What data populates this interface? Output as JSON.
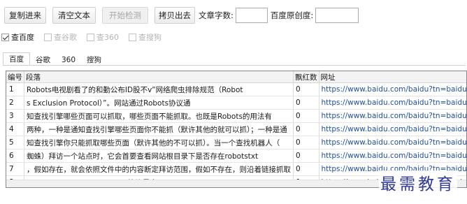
{
  "toolbar": {
    "copy_in_label": "复制进来",
    "clear_label": "清空文本",
    "start_label": "开始检测",
    "copy_out_label": "拷贝出去",
    "char_count_label": "文章字数:",
    "char_count_value": "",
    "originality_label": "百度原创度:",
    "originality_value": ""
  },
  "engines": [
    {
      "label": "查百度",
      "checked": true
    },
    {
      "label": "查谷歌",
      "checked": false
    },
    {
      "label": "查360",
      "checked": false
    },
    {
      "label": "查搜狗",
      "checked": false
    }
  ],
  "tabs": [
    "百度",
    "谷歌",
    "360",
    "搜狗"
  ],
  "table": {
    "headers": [
      "编号",
      "段落",
      "飘红数",
      "网址"
    ],
    "rows": [
      {
        "no": "1",
        "para": "Robots电视剧看了的和勤公布ID股不v”网络爬虫排除规范（Robot",
        "red": "0",
        "url": "https://www.baidu.com/baidu?tn=baidu&word=f"
      },
      {
        "no": "2",
        "para": "s Exclusion Protocol）”。网站通过Robots协议通",
        "red": "0",
        "url": "https://www.baidu.com/baidu?tn=baidu&word=s"
      },
      {
        "no": "3",
        "para": "知查找引擎哪些页面可以抓取，哪些页面不能抓取。也既是Robots的用法有",
        "red": "0",
        "url": "https://www.baidu.com/baidu?tn=baidu&word=9"
      },
      {
        "no": "4",
        "para": "两种，一种是通知查找引擎哪些页面你不能抓（默许其他的就可以抓）；一种是通",
        "red": "0",
        "url": "https://www.baidu.com/baidu?tn=baidu&word=9"
      },
      {
        "no": "5",
        "para": "知查找引擎你只能抓取哪些页面（默许其他的不可以抓）。当一个查找机器人（",
        "red": "0",
        "url": "https://www.baidu.com/baidu?tn=baidu&word=9"
      },
      {
        "no": "6",
        "para": "蜘蛛）拜访一个站点时，它会首要查看网站根目录下是否存在robotstxt",
        "red": "0",
        "url": "https://www.baidu.com/baidu?tn=baidu&word=9"
      },
      {
        "no": "7",
        "para": "，假如存在，就会依照文件中的内容断定拜访范围，假如不存在，则沿着链接抓取",
        "red": "0",
        "url": "https://www.baidu.com/baidu?tn=baidu&wo_=9"
      },
      {
        "no": "8",
        "para": "，Robots Exclusion Protocol协议是中 Mart",
        "red": "0",
        "url": "https://www.baidu.com/baidu?tn=baidu&word=9"
      }
    ]
  },
  "watermark": "最需教育"
}
